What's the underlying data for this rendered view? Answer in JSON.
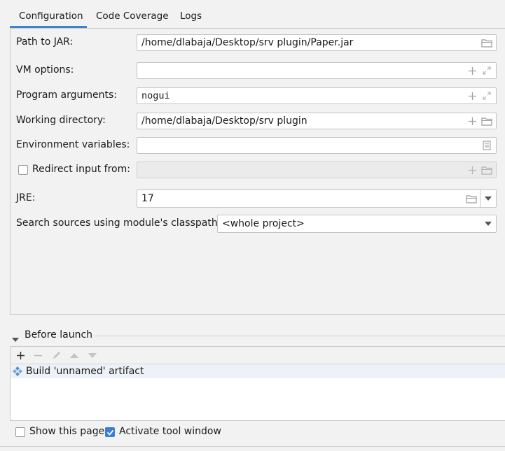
{
  "tabs": [
    "Configuration",
    "Code Coverage",
    "Logs"
  ],
  "active_tab": "Configuration",
  "form": {
    "path_to_jar": {
      "label": "Path to JAR:",
      "value": "/home/dlabaja/Desktop/srv plugin/Paper.jar"
    },
    "vm_options": {
      "label": "VM options:",
      "value": ""
    },
    "program_arguments": {
      "label": "Program arguments:",
      "value": "nogui"
    },
    "working_directory": {
      "label": "Working directory:",
      "value": "/home/dlabaja/Desktop/srv plugin"
    },
    "environment_variables": {
      "label": "Environment variables:",
      "value": ""
    },
    "redirect_input": {
      "label": "Redirect input from:",
      "checked": false,
      "value": ""
    },
    "jre": {
      "label": "JRE:",
      "value": "17"
    },
    "search_sources": {
      "label": "Search sources using module's classpath:",
      "value": "<whole project>"
    }
  },
  "before_launch": {
    "title": "Before launch",
    "toolbar_icons": [
      "add-icon",
      "remove-icon",
      "edit-icon",
      "move-up-icon",
      "move-down-icon"
    ],
    "items": [
      "Build 'unnamed' artifact"
    ]
  },
  "footer": {
    "show_this_page": {
      "label": "Show this page",
      "checked": false
    },
    "activate_tool_window": {
      "label": "Activate tool window",
      "checked": true
    }
  },
  "colors": {
    "accent": "#4083c9",
    "checkbox_checked": "#3d7fd1",
    "selected_row": "#edf2f8"
  }
}
